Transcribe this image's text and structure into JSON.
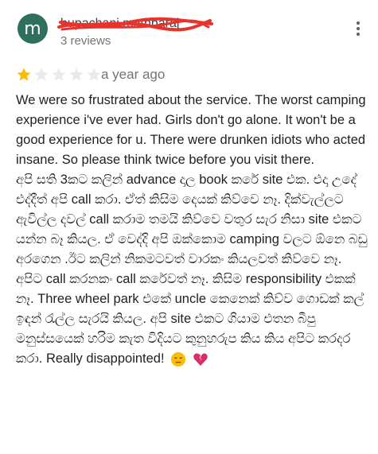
{
  "reviewer": {
    "avatar_letter": "m",
    "avatar_color": "#2f6f5e",
    "name": "bupachani mathbaraj",
    "reviews_count": "3 reviews"
  },
  "review": {
    "rating": 1,
    "max_rating": 5,
    "time": "a year ago",
    "paragraph_1": "We were so frustrated about the service. The worst camping experience i've ever had. Girls don't go alone. It won't be a good experience for u. There were drunken idiots who acted insane. So please think twice before you visit there.",
    "paragraph_2": "අපි සති 3කට කලින් advance දාල book කරේ site එක. එදා උදේ එද්දීත් අපි call කරා. ඒත් කිසිම දෙයක් කිව්වෙ නෑ. දික්වැල්ලට ඇවිල්ල දවල් call කරාම තමයි කිව්වෙ වතුර සැර නිසා site එකට යන්න බෑ කියල. ඒ වෙද්දි අපි ඔක්කොම camping වලට ඕනෙ බඩු අරගෙන .ඊට කලින් නිකමටවත් වාරකං කියලවත් කිව්වෙ නෑ. අපිට call කරනකං call කරේවත් නෑ. කිසිම responsibility එකක් නෑ. Three wheel park එකේ uncle කෙනෙක් කිව්ව ගොඩක් කල් ඉඳන් රැල්ල සැරයි කියල. අපි site එකට ගියාම එතන බීපු මනුස්සයෙක් හරිම කැත විදියට කුනුහරුප කිය කිය අපිට කරදර කරා. Really disappointed!"
  },
  "colors": {
    "star_filled": "#fbbc04",
    "star_empty": "#e8eaed",
    "redaction": "#e8322b"
  },
  "icons": [
    "more-vert-icon",
    "star-icon",
    "expressionless-emoji-icon",
    "broken-heart-emoji-icon"
  ]
}
